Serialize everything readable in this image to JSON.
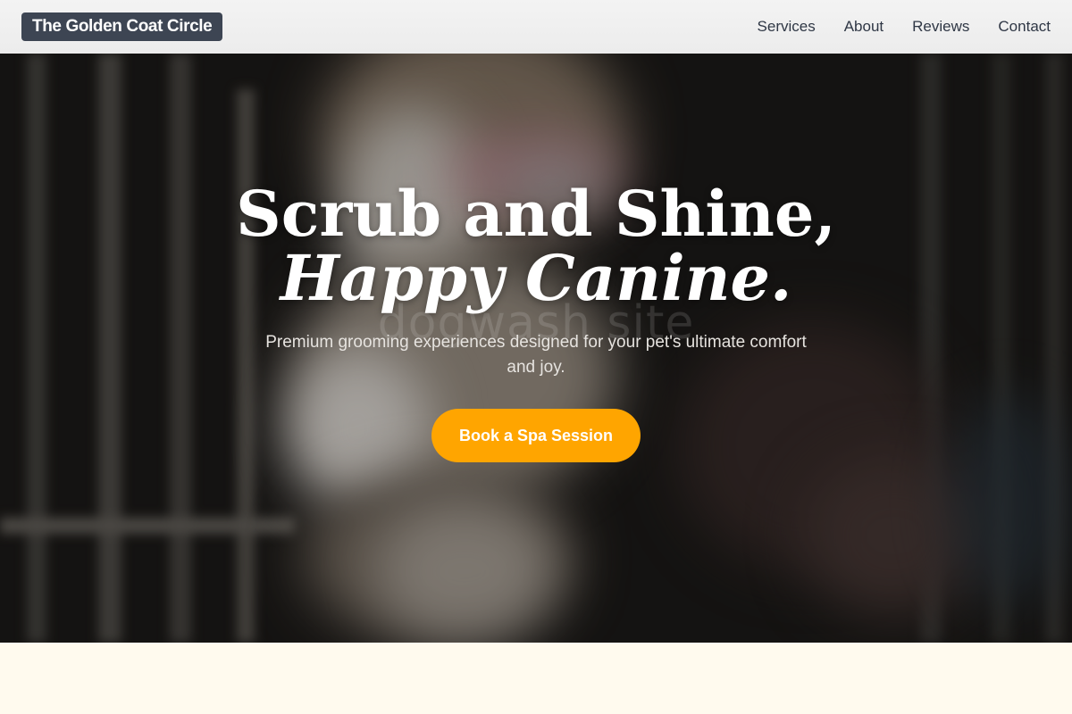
{
  "header": {
    "logo": "The Golden Coat Circle",
    "nav": [
      "Services",
      "About",
      "Reviews",
      "Contact"
    ]
  },
  "hero": {
    "headline_line1": "Scrub and Shine,",
    "headline_line2": "Happy Canine.",
    "watermark": "dogwash site",
    "subtitle": "Premium grooming experiences designed for your pet's ultimate comfort and joy.",
    "cta_label": "Book a Spa Session",
    "background_image": "blurred photo of a tabby-and-white kitten with a pink collar climbing a cage"
  },
  "colors": {
    "accent": "#ffa500",
    "logo_bg": "#3d4553",
    "nav_text": "#2f3745",
    "page_bg": "#fffaee"
  }
}
